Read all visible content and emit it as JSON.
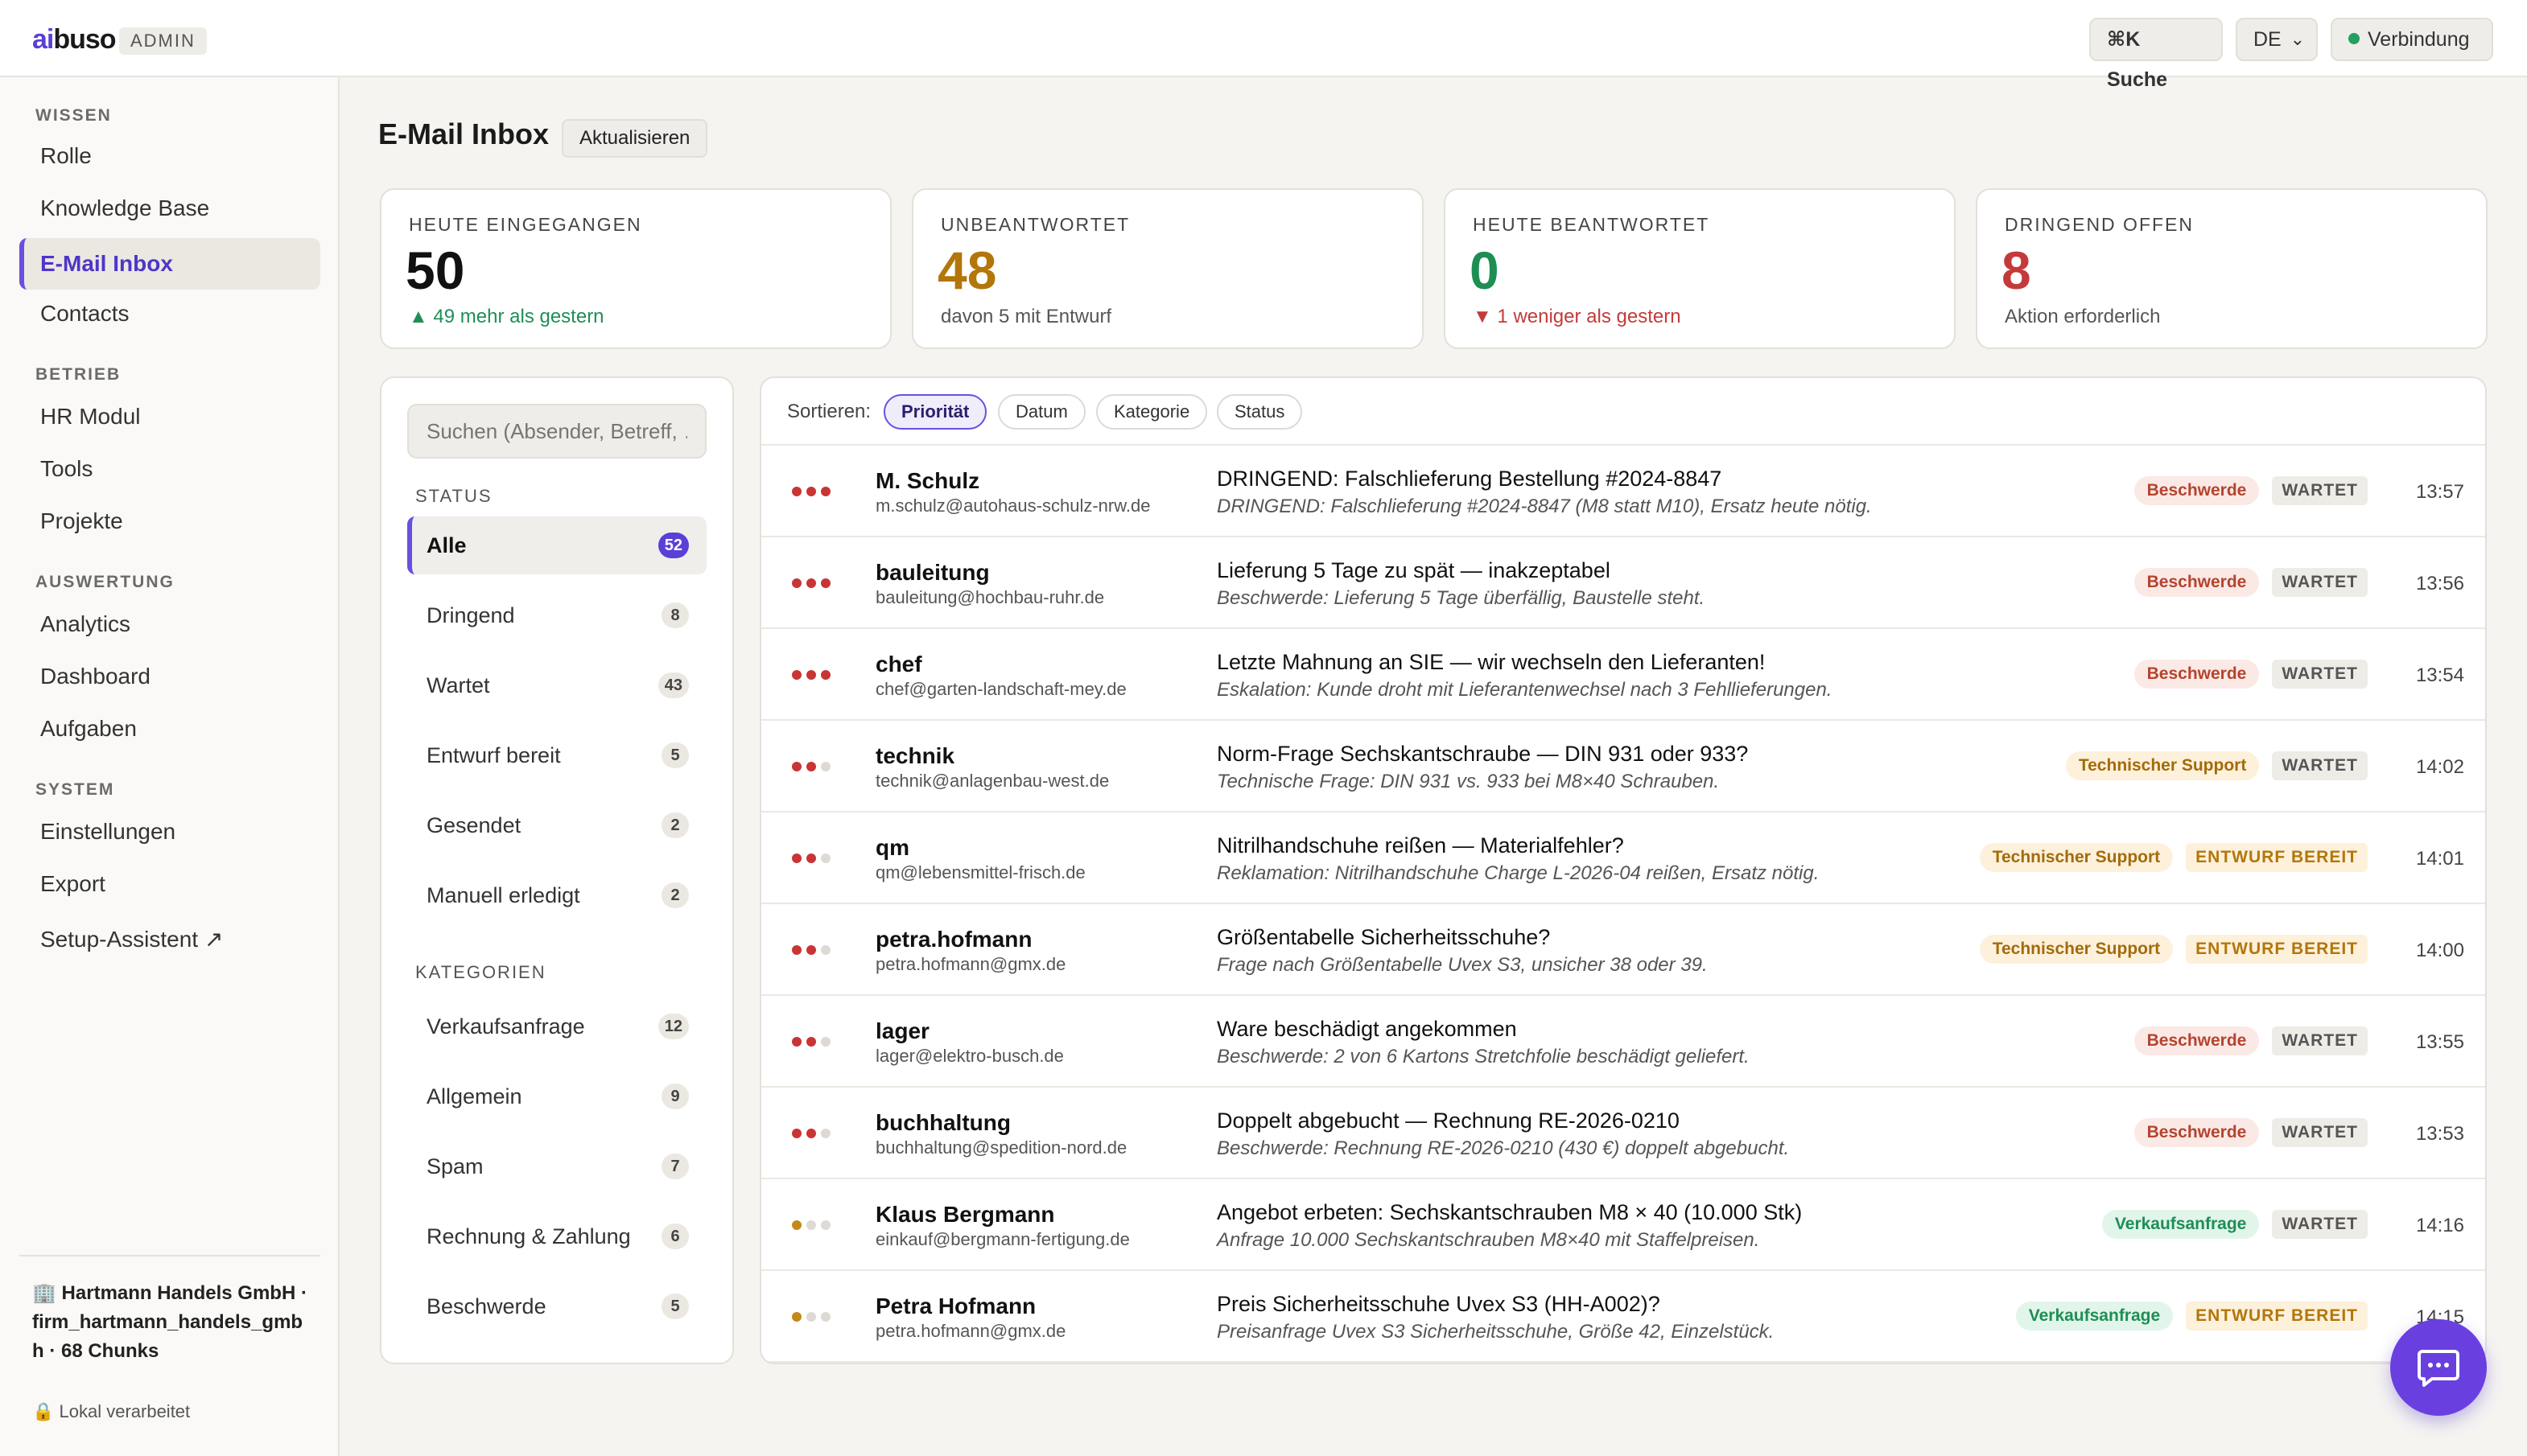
{
  "app": {
    "logo_prefix": "ai",
    "logo_rest": "buso",
    "admin_badge": "ADMIN",
    "search_label": "⌘K Suche",
    "language": "DE",
    "connection": "Verbindung",
    "colors": {
      "accent": "#5b3fd6",
      "connection": "#22a060"
    }
  },
  "sidebar": {
    "sections": [
      {
        "title": "WISSEN",
        "items": [
          "Rolle",
          "Knowledge Base",
          "E-Mail Inbox",
          "Contacts"
        ]
      },
      {
        "title": "BETRIEB",
        "items": [
          "HR Modul",
          "Tools",
          "Projekte"
        ]
      },
      {
        "title": "AUSWERTUNG",
        "items": [
          "Analytics",
          "Dashboard",
          "Aufgaben"
        ]
      },
      {
        "title": "SYSTEM",
        "items": [
          "Einstellungen",
          "Export",
          "Setup-Assistent ↗"
        ]
      }
    ],
    "active": "E-Mail Inbox",
    "firm": "🏢 Hartmann Handels GmbH · firm_hartmann_handels_gmbh · 68 Chunks",
    "local": "🔒 Lokal verarbeitet"
  },
  "header": {
    "title": "E-Mail Inbox",
    "refresh": "Aktualisieren"
  },
  "stats": [
    {
      "label": "HEUTE EINGEGANGEN",
      "value": "50",
      "sub": "▲ 49 mehr als gestern",
      "value_color": "#111111",
      "sub_tone": "up"
    },
    {
      "label": "UNBEANTWORTET",
      "value": "48",
      "sub": "davon 5 mit Entwurf",
      "value_color": "#b3760a",
      "sub_tone": "neutral"
    },
    {
      "label": "HEUTE BEANTWORTET",
      "value": "0",
      "sub": "▼ 1 weniger als gestern",
      "value_color": "#1d8f55",
      "sub_tone": "down"
    },
    {
      "label": "DRINGEND OFFEN",
      "value": "8",
      "sub": "Aktion erforderlich",
      "value_color": "#c43a3a",
      "sub_tone": "neutral"
    }
  ],
  "filters": {
    "search_placeholder": "Suchen (Absender, Betreff, …)",
    "status_title": "STATUS",
    "status": [
      {
        "label": "Alle",
        "count": "52",
        "active": true
      },
      {
        "label": "Dringend",
        "count": "8"
      },
      {
        "label": "Wartet",
        "count": "43"
      },
      {
        "label": "Entwurf bereit",
        "count": "5"
      },
      {
        "label": "Gesendet",
        "count": "2"
      },
      {
        "label": "Manuell erledigt",
        "count": "2"
      }
    ],
    "categories_title": "KATEGORIEN",
    "categories": [
      {
        "label": "Verkaufsanfrage",
        "count": "12"
      },
      {
        "label": "Allgemein",
        "count": "9"
      },
      {
        "label": "Spam",
        "count": "7"
      },
      {
        "label": "Rechnung & Zahlung",
        "count": "6"
      },
      {
        "label": "Beschwerde",
        "count": "5"
      }
    ]
  },
  "sort": {
    "label": "Sortieren:",
    "options": [
      "Priorität",
      "Datum",
      "Kategorie",
      "Status"
    ],
    "active": "Priorität"
  },
  "emails": [
    {
      "priority": 3,
      "sender": "M. Schulz",
      "email": "m.schulz@autohaus-schulz-nrw.de",
      "subject": "DRINGEND: Falschlieferung Bestellung #2024-8847",
      "preview": "DRINGEND: Falschlieferung #2024-8847 (M8 statt M10), Ersatz heute nötig.",
      "category": "Beschwerde",
      "status": "WARTET",
      "time": "13:57"
    },
    {
      "priority": 3,
      "sender": "bauleitung",
      "email": "bauleitung@hochbau-ruhr.de",
      "subject": "Lieferung 5 Tage zu spät — inakzeptabel",
      "preview": "Beschwerde: Lieferung 5 Tage überfällig, Baustelle steht.",
      "category": "Beschwerde",
      "status": "WARTET",
      "time": "13:56"
    },
    {
      "priority": 3,
      "sender": "chef",
      "email": "chef@garten-landschaft-mey.de",
      "subject": "Letzte Mahnung an SIE — wir wechseln den Lieferanten!",
      "preview": "Eskalation: Kunde droht mit Lieferantenwechsel nach 3 Fehllieferungen.",
      "category": "Beschwerde",
      "status": "WARTET",
      "time": "13:54"
    },
    {
      "priority": 2,
      "sender": "technik",
      "email": "technik@anlagenbau-west.de",
      "subject": "Norm-Frage Sechskantschraube — DIN 931 oder 933?",
      "preview": "Technische Frage: DIN 931 vs. 933 bei M8×40 Schrauben.",
      "category": "Technischer Support",
      "status": "WARTET",
      "time": "14:02"
    },
    {
      "priority": 2,
      "sender": "qm",
      "email": "qm@lebensmittel-frisch.de",
      "subject": "Nitrilhandschuhe reißen — Materialfehler?",
      "preview": "Reklamation: Nitrilhandschuhe Charge L-2026-04 reißen, Ersatz nötig.",
      "category": "Technischer Support",
      "status": "ENTWURF BEREIT",
      "time": "14:01"
    },
    {
      "priority": 2,
      "sender": "petra.hofmann",
      "email": "petra.hofmann@gmx.de",
      "subject": "Größentabelle Sicherheitsschuhe?",
      "preview": "Frage nach Größentabelle Uvex S3, unsicher 38 oder 39.",
      "category": "Technischer Support",
      "status": "ENTWURF BEREIT",
      "time": "14:00"
    },
    {
      "priority": 2,
      "sender": "lager",
      "email": "lager@elektro-busch.de",
      "subject": "Ware beschädigt angekommen",
      "preview": "Beschwerde: 2 von 6 Kartons Stretchfolie beschädigt geliefert.",
      "category": "Beschwerde",
      "status": "WARTET",
      "time": "13:55"
    },
    {
      "priority": 2,
      "sender": "buchhaltung",
      "email": "buchhaltung@spedition-nord.de",
      "subject": "Doppelt abgebucht — Rechnung RE-2026-0210",
      "preview": "Beschwerde: Rechnung RE-2026-0210 (430 €) doppelt abgebucht.",
      "category": "Beschwerde",
      "status": "WARTET",
      "time": "13:53"
    },
    {
      "priority": 1,
      "sender": "Klaus Bergmann",
      "email": "einkauf@bergmann-fertigung.de",
      "subject": "Angebot erbeten: Sechskantschrauben M8 × 40 (10.000 Stk)",
      "preview": "Anfrage 10.000 Sechskantschrauben M8×40 mit Staffelpreisen.",
      "category": "Verkaufsanfrage",
      "status": "WARTET",
      "time": "14:16"
    },
    {
      "priority": 1,
      "sender": "Petra Hofmann",
      "email": "petra.hofmann@gmx.de",
      "subject": "Preis Sicherheitsschuhe Uvex S3 (HH-A002)?",
      "preview": "Preisanfrage Uvex S3 Sicherheitsschuhe, Größe 42, Einzelstück.",
      "category": "Verkaufsanfrage",
      "status": "ENTWURF BEREIT",
      "time": "14:15"
    }
  ],
  "chat_icon": "chat-bubble-icon"
}
